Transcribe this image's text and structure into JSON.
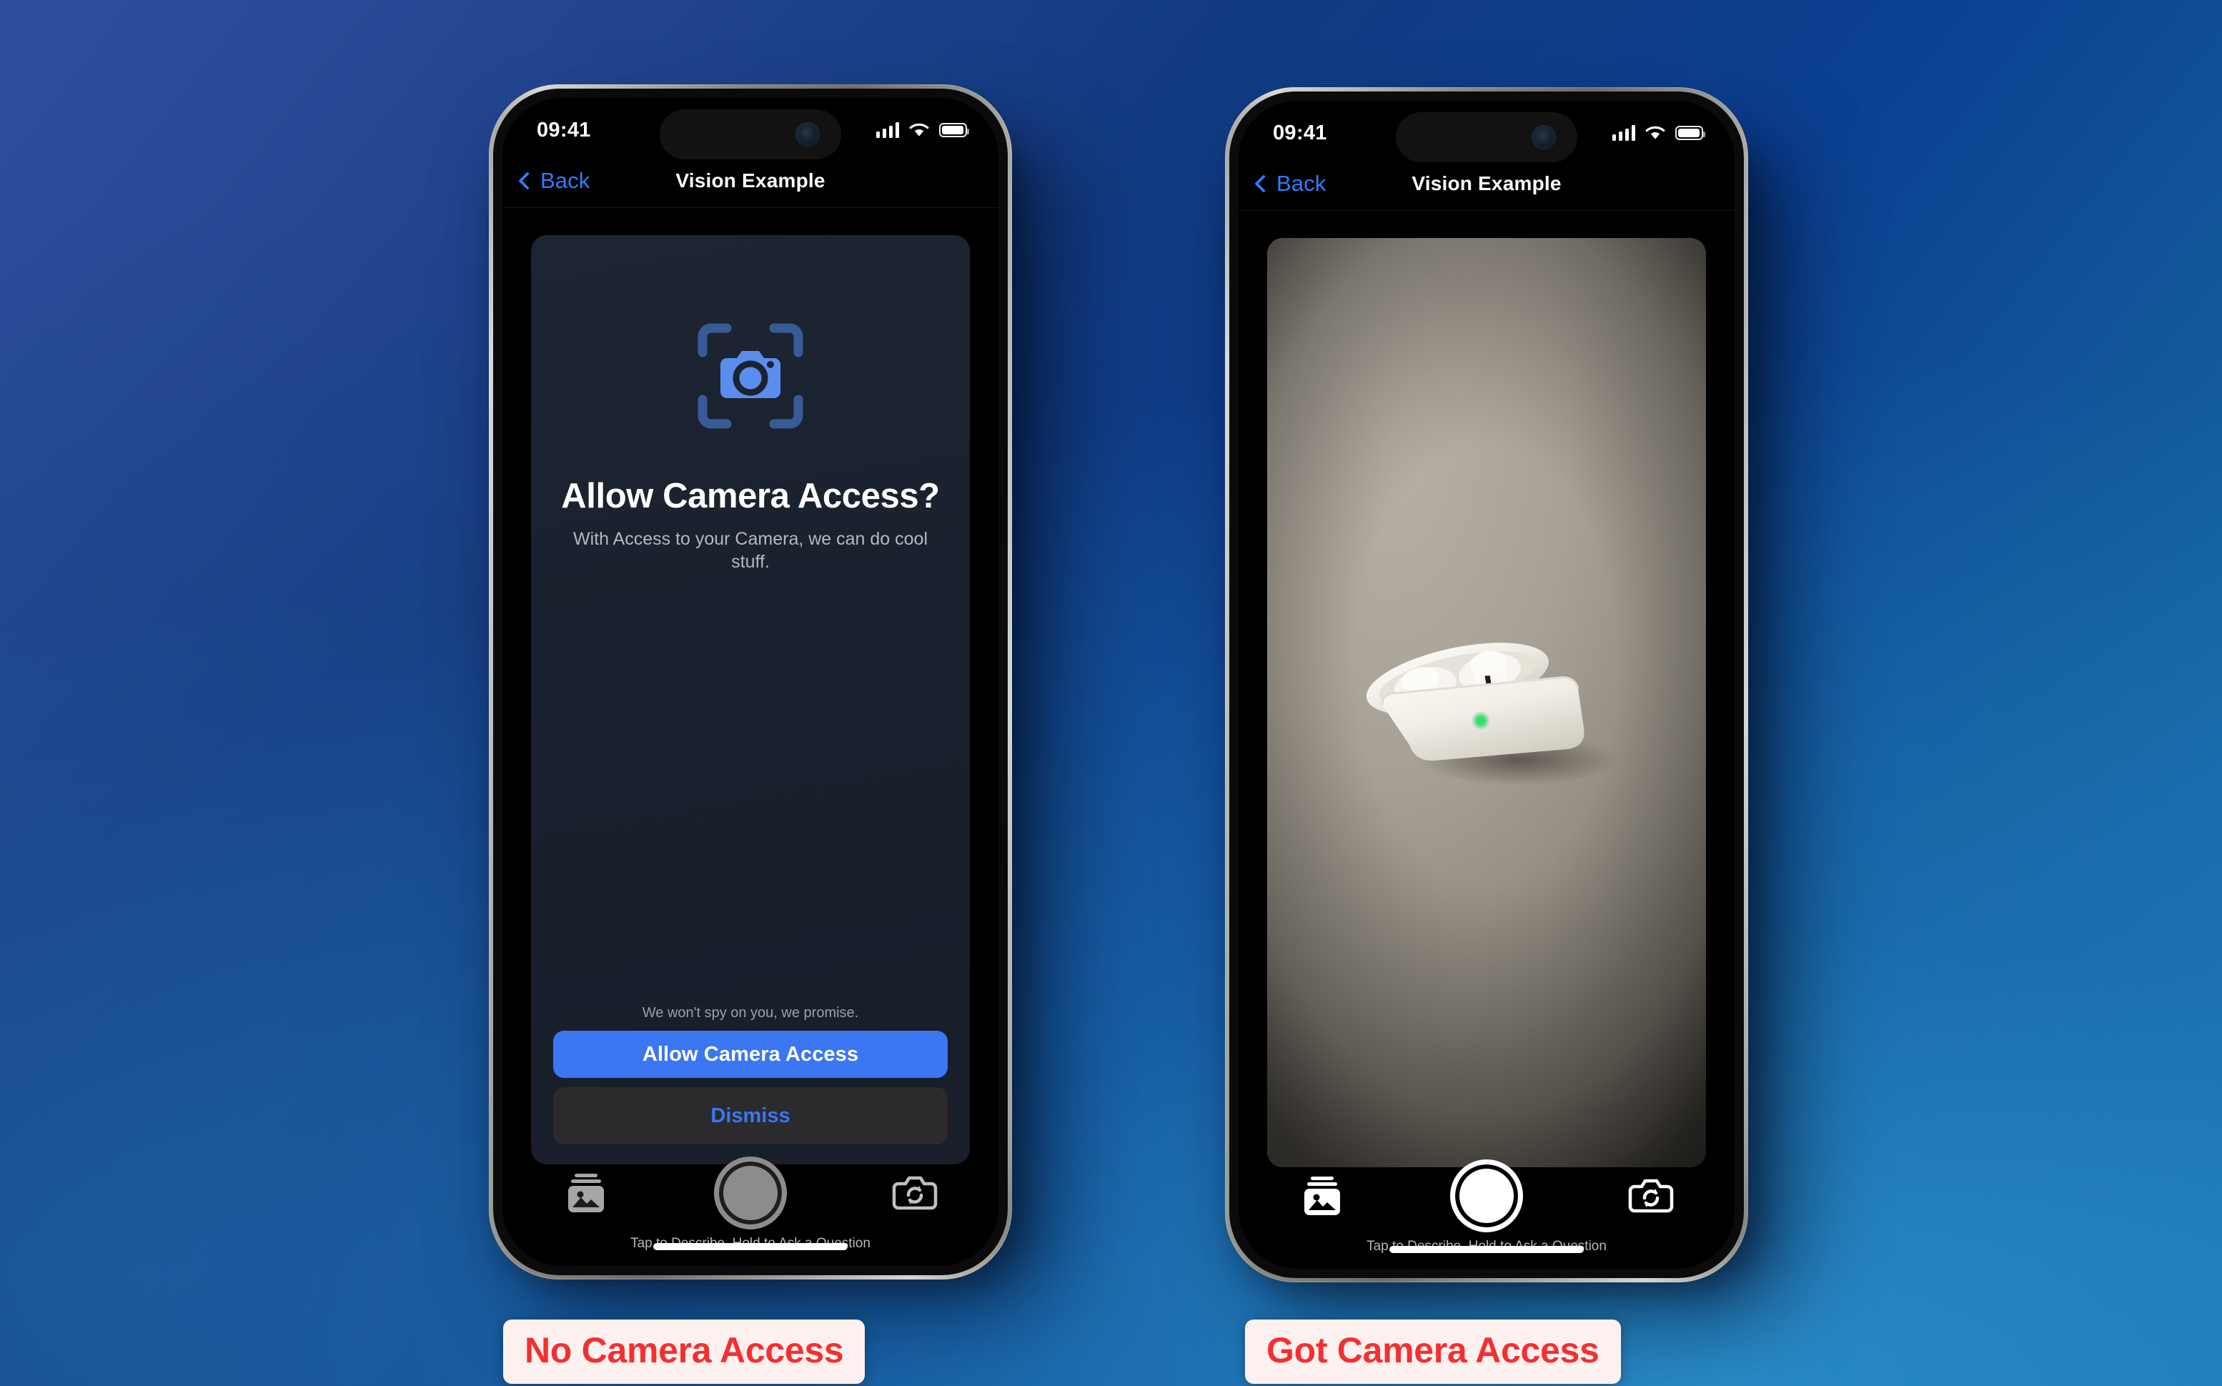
{
  "background": {
    "gradient_from": "#2f4f9e",
    "gradient_mid": "#0b3f91",
    "gradient_to": "#1e7bbd"
  },
  "colors": {
    "accent_blue": "#3b76f3",
    "link_blue": "#2f7dfb",
    "caption_red": "#f33030",
    "caption_bg": "#fdf1f0",
    "card_bg": "#1a212e",
    "icon_blue_bright": "#5b8def",
    "icon_blue_dark": "#3a5a96",
    "led_green": "#27d95e"
  },
  "phones": [
    {
      "id": "no-access",
      "caption": "No Camera Access",
      "status_bar": {
        "time": "09:41",
        "cellular_icon": "cellular-bars-icon",
        "wifi_icon": "wifi-icon",
        "battery_icon": "battery-full-icon"
      },
      "nav": {
        "back_label": "Back",
        "back_icon": "chevron-left-icon",
        "title": "Vision Example"
      },
      "permission_card": {
        "icon": "camera-viewfinder-icon",
        "title": "Allow Camera Access?",
        "subtitle": "With Access to your Camera, we can do cool stuff.",
        "note": "We won't spy on you, we promise.",
        "primary_button": "Allow Camera Access",
        "secondary_button": "Dismiss"
      },
      "controls": {
        "gallery_icon": "photo-stack-icon",
        "shutter_icon": "shutter-button",
        "shutter_state": "disabled",
        "flip_icon": "camera-rotate-icon",
        "hint": "Tap to Describe, Hold to Ask a Question",
        "home_indicator": "home-indicator"
      }
    },
    {
      "id": "got-access",
      "caption": "Got Camera Access",
      "status_bar": {
        "time": "09:41",
        "cellular_icon": "cellular-bars-icon",
        "wifi_icon": "wifi-icon",
        "battery_icon": "battery-full-icon"
      },
      "nav": {
        "back_label": "Back",
        "back_icon": "chevron-left-icon",
        "title": "Vision Example"
      },
      "preview": {
        "subject": "AirPods Pro charging case, open, on a grey desk surface",
        "led": "green status light"
      },
      "controls": {
        "gallery_icon": "photo-stack-icon",
        "shutter_icon": "shutter-button",
        "shutter_state": "enabled",
        "flip_icon": "camera-rotate-icon",
        "hint": "Tap to Describe, Hold to Ask a Question",
        "home_indicator": "home-indicator"
      }
    }
  ]
}
